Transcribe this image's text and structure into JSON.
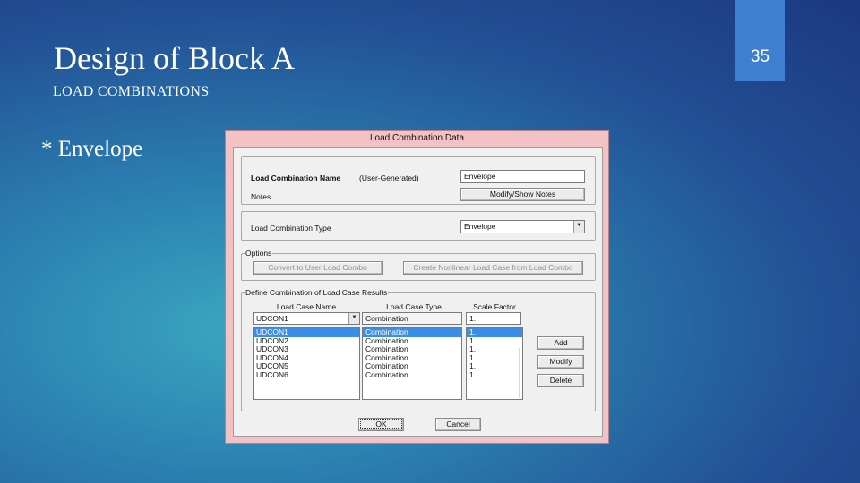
{
  "slide": {
    "title": "Design of Block A",
    "subtitle": "LOAD COMBINATIONS",
    "page_number": "35",
    "bullet": "* Envelope"
  },
  "dialog": {
    "title": "Load Combination Data",
    "name_label": "Load Combination Name",
    "name_suffix": "(User-Generated)",
    "name_value": "Envelope",
    "notes_label": "Notes",
    "notes_button": "Modify/Show Notes",
    "type_label": "Load Combination Type",
    "type_value": "Envelope",
    "options_legend": "Options",
    "options_button_1": "Convert to User Load Combo",
    "options_button_2": "Create Nonlinear Load Case from Load Combo",
    "define_legend": "Define Combination of Load Case Results",
    "columns": {
      "name": "Load Case Name",
      "type": "Load Case Type",
      "scale": "Scale Factor"
    },
    "edit_row": {
      "name": "UDCON1",
      "type": "Combination",
      "scale": "1."
    },
    "rows": [
      {
        "name": "UDCON1",
        "type": "Combination",
        "scale": "1."
      },
      {
        "name": "UDCON2",
        "type": "Combination",
        "scale": "1."
      },
      {
        "name": "UDCON3",
        "type": "Combination",
        "scale": "1."
      },
      {
        "name": "UDCON4",
        "type": "Combination",
        "scale": "1."
      },
      {
        "name": "UDCON5",
        "type": "Combination",
        "scale": "1."
      },
      {
        "name": "UDCON6",
        "type": "Combination",
        "scale": "1."
      }
    ],
    "add_button": "Add",
    "modify_button": "Modify",
    "delete_button": "Delete",
    "ok_button": "OK",
    "cancel_button": "Cancel"
  },
  "colors": {
    "dialog_frame": "#f4c2c5",
    "selection": "#3a8ee6",
    "page_number_box": "#3e7fd0"
  }
}
